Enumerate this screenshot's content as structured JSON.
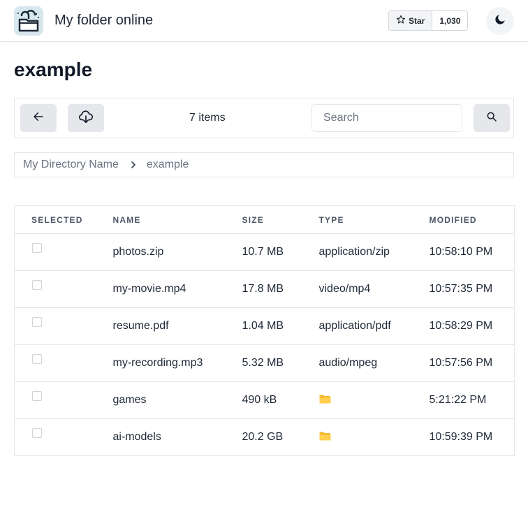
{
  "navbar": {
    "title": "My folder online",
    "star_label": "Star",
    "star_count": "1,030"
  },
  "page": {
    "title": "example"
  },
  "toolbar": {
    "items_count": "7 items",
    "search_placeholder": "Search"
  },
  "breadcrumb": {
    "root": "My Directory Name",
    "current": "example"
  },
  "table": {
    "headers": {
      "selected": "SELECTED",
      "name": "NAME",
      "size": "SIZE",
      "type": "TYPE",
      "modified": "MODIFIED"
    },
    "rows": [
      {
        "name": "photos.zip",
        "size": "10.7 MB",
        "type": "application/zip",
        "modified": "10:58:10 PM"
      },
      {
        "name": "my-movie.mp4",
        "size": "17.8 MB",
        "type": "video/mp4",
        "modified": "10:57:35 PM"
      },
      {
        "name": "resume.pdf",
        "size": "1.04 MB",
        "type": "application/pdf",
        "modified": "10:58:29 PM"
      },
      {
        "name": "my-recording.mp3",
        "size": "5.32 MB",
        "type": "audio/mpeg",
        "modified": "10:57:56 PM"
      },
      {
        "name": "games",
        "size": "490 kB",
        "type": "folder-icon",
        "modified": "5:21:22 PM"
      },
      {
        "name": "ai-models",
        "size": "20.2 GB",
        "type": "folder-icon",
        "modified": "10:59:39 PM"
      }
    ]
  },
  "icons": {
    "logo": "folder-lock-logo-icon",
    "star": "star-icon",
    "theme": "moon-icon",
    "back": "arrow-left-icon",
    "download": "cloud-download-icon",
    "search": "search-icon",
    "separator": "chevron-right-icon",
    "folder": "folder-icon"
  },
  "colors": {
    "border": "#e5e7eb",
    "button_bg": "#e5e7eb",
    "folder": "#f5b731",
    "logo_bg": "#d7e7ee"
  }
}
